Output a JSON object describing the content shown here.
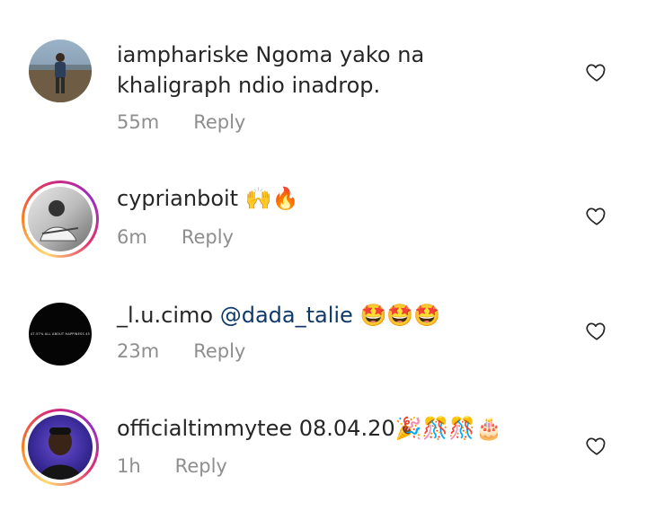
{
  "comments": [
    {
      "username": "iamphariske",
      "text": " Ngoma yako na khaligraph ndio inadrop.",
      "time": "55m",
      "reply_label": "Reply",
      "has_story_ring": false
    },
    {
      "username": "cyprianboit",
      "text": " 🙌🔥",
      "time": "6m",
      "reply_label": "Reply",
      "has_story_ring": true
    },
    {
      "username": "_l.u.cimo",
      "mention": "@dada_talie",
      "text": " 🤩🤩🤩",
      "time": "23m",
      "reply_label": "Reply",
      "has_story_ring": false,
      "avatar_caption": "47.57% ALL ABOUT HAPPINESS 45"
    },
    {
      "username": "officialtimmytee",
      "text": " 08.04.20🎉🎊🎊🎂",
      "time": "1h",
      "reply_label": "Reply",
      "has_story_ring": true
    }
  ],
  "icons": {
    "like": "heart-outline-icon"
  },
  "colors": {
    "text": "#262626",
    "meta": "#8e8e8e",
    "mention": "#0e3a6b"
  }
}
